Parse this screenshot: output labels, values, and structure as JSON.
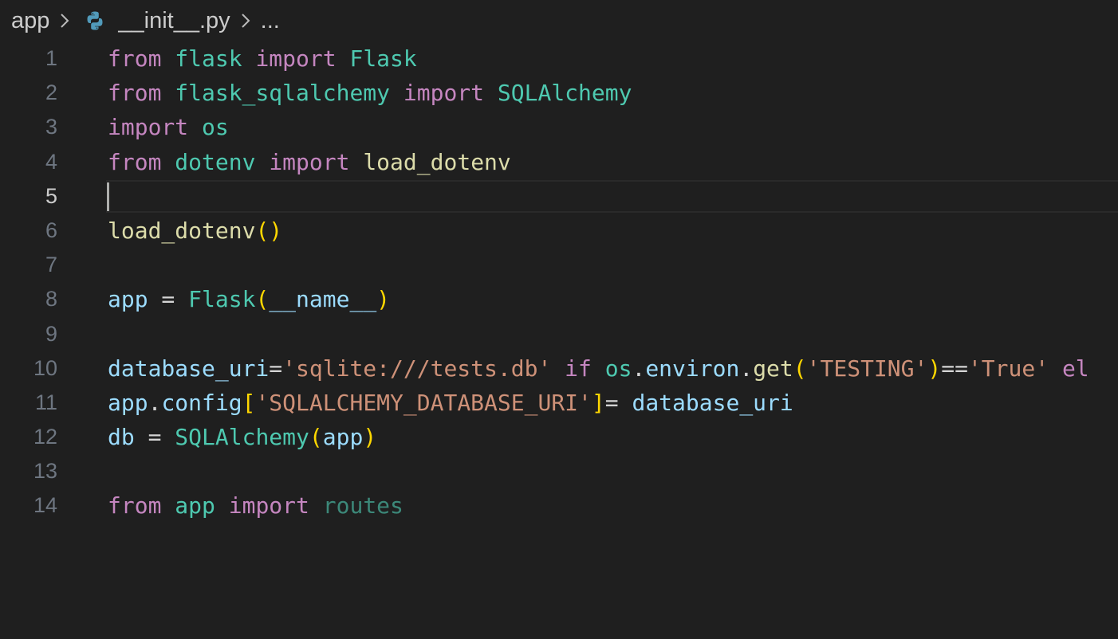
{
  "breadcrumb": {
    "folder": "app",
    "file": "__init__.py",
    "more": "..."
  },
  "editor": {
    "current_line": 5,
    "lines": [
      {
        "n": "1",
        "tokens": [
          [
            "kw",
            "from"
          ],
          [
            "op",
            " "
          ],
          [
            "mod",
            "flask"
          ],
          [
            "op",
            " "
          ],
          [
            "kw",
            "import"
          ],
          [
            "op",
            " "
          ],
          [
            "cls",
            "Flask"
          ]
        ]
      },
      {
        "n": "2",
        "tokens": [
          [
            "kw",
            "from"
          ],
          [
            "op",
            " "
          ],
          [
            "mod",
            "flask_sqlalchemy"
          ],
          [
            "op",
            " "
          ],
          [
            "kw",
            "import"
          ],
          [
            "op",
            " "
          ],
          [
            "cls",
            "SQLAlchemy"
          ]
        ]
      },
      {
        "n": "3",
        "tokens": [
          [
            "kw",
            "import"
          ],
          [
            "op",
            " "
          ],
          [
            "mod",
            "os"
          ]
        ]
      },
      {
        "n": "4",
        "tokens": [
          [
            "kw",
            "from"
          ],
          [
            "op",
            " "
          ],
          [
            "mod",
            "dotenv"
          ],
          [
            "op",
            " "
          ],
          [
            "kw",
            "import"
          ],
          [
            "op",
            " "
          ],
          [
            "fn",
            "load_dotenv"
          ]
        ]
      },
      {
        "n": "5",
        "tokens": []
      },
      {
        "n": "6",
        "tokens": [
          [
            "fn",
            "load_dotenv"
          ],
          [
            "br1",
            "()"
          ]
        ]
      },
      {
        "n": "7",
        "tokens": []
      },
      {
        "n": "8",
        "tokens": [
          [
            "var",
            "app"
          ],
          [
            "op",
            " = "
          ],
          [
            "cls",
            "Flask"
          ],
          [
            "br1",
            "("
          ],
          [
            "var",
            "__name__"
          ],
          [
            "br1",
            ")"
          ]
        ]
      },
      {
        "n": "9",
        "tokens": []
      },
      {
        "n": "10",
        "tokens": [
          [
            "var",
            "database_uri"
          ],
          [
            "op",
            "="
          ],
          [
            "str",
            "'sqlite:///tests.db'"
          ],
          [
            "op",
            " "
          ],
          [
            "kw",
            "if"
          ],
          [
            "op",
            " "
          ],
          [
            "mod",
            "os"
          ],
          [
            "op",
            "."
          ],
          [
            "var",
            "environ"
          ],
          [
            "op",
            "."
          ],
          [
            "fn",
            "get"
          ],
          [
            "br1",
            "("
          ],
          [
            "str",
            "'TESTING'"
          ],
          [
            "br1",
            ")"
          ],
          [
            "op",
            "=="
          ],
          [
            "str",
            "'True'"
          ],
          [
            "op",
            " "
          ],
          [
            "kw",
            "el"
          ]
        ]
      },
      {
        "n": "11",
        "tokens": [
          [
            "var",
            "app"
          ],
          [
            "op",
            "."
          ],
          [
            "var",
            "config"
          ],
          [
            "br1",
            "["
          ],
          [
            "str",
            "'SQLALCHEMY_DATABASE_URI'"
          ],
          [
            "br1",
            "]"
          ],
          [
            "op",
            "= "
          ],
          [
            "var",
            "database_uri"
          ]
        ]
      },
      {
        "n": "12",
        "tokens": [
          [
            "var",
            "db"
          ],
          [
            "op",
            " = "
          ],
          [
            "cls",
            "SQLAlchemy"
          ],
          [
            "br1",
            "("
          ],
          [
            "var",
            "app"
          ],
          [
            "br1",
            ")"
          ]
        ]
      },
      {
        "n": "13",
        "tokens": []
      },
      {
        "n": "14",
        "tokens": [
          [
            "kw",
            "from"
          ],
          [
            "op",
            " "
          ],
          [
            "mod",
            "app"
          ],
          [
            "op",
            " "
          ],
          [
            "kw",
            "import"
          ],
          [
            "op",
            " "
          ],
          [
            "dim",
            "routes"
          ]
        ]
      }
    ]
  },
  "colors": {
    "background": "#1f1f1f",
    "keyword": "#c586c0",
    "module": "#4ec9b0",
    "function": "#dcdcaa",
    "variable": "#9cdcfe",
    "string": "#ce9178",
    "bracket": "#ffd700"
  },
  "icons": {
    "separator": "chevron-right-icon",
    "file_type": "python-icon"
  }
}
